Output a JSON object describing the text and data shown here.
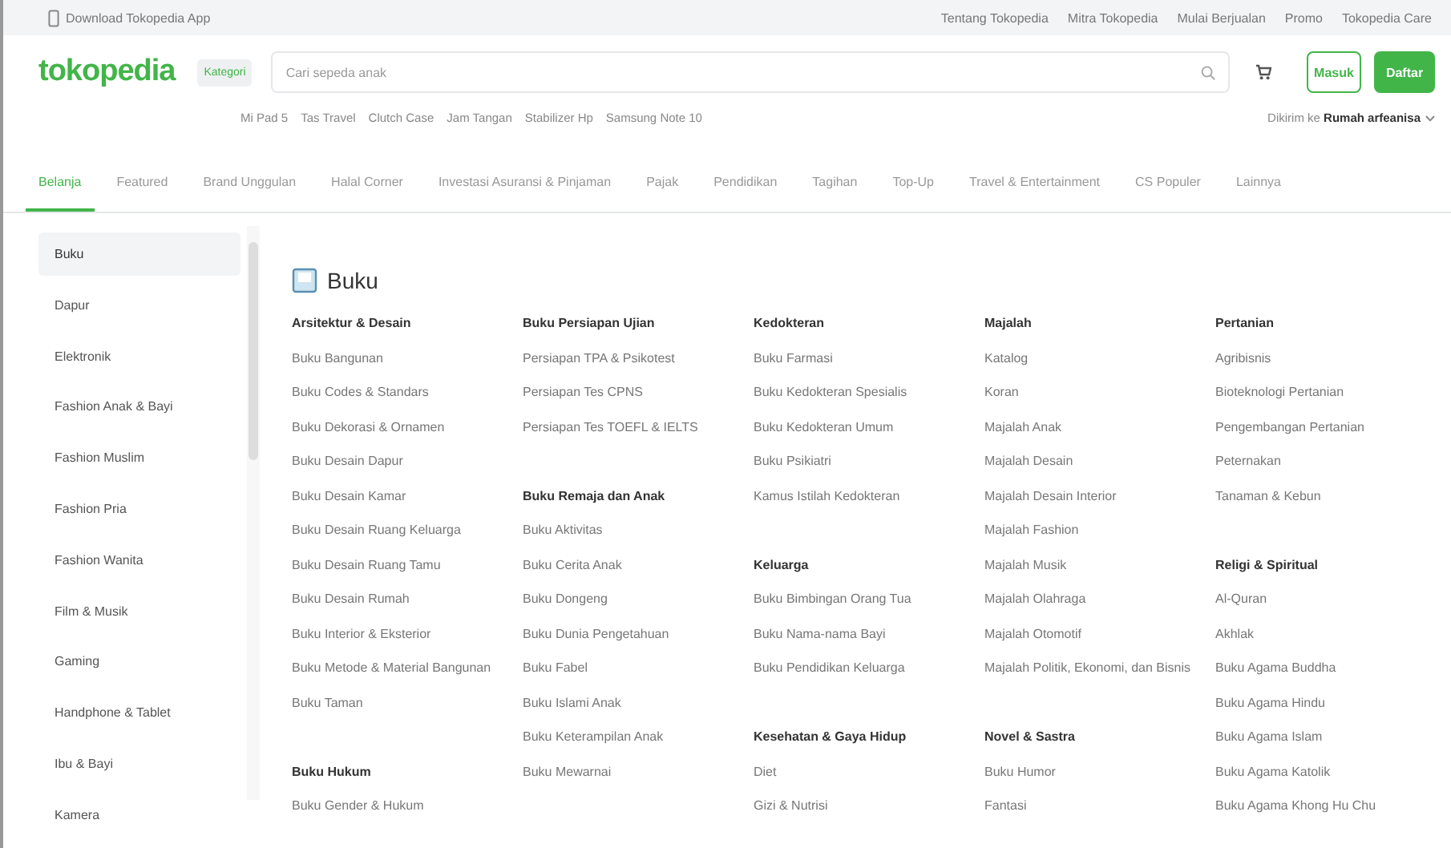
{
  "topbar": {
    "app_link": "Download Tokopedia App",
    "links": [
      "Tentang Tokopedia",
      "Mitra Tokopedia",
      "Mulai Berjualan",
      "Promo",
      "Tokopedia Care"
    ]
  },
  "header": {
    "logo": "tokopedia",
    "category_button": "Kategori",
    "search": {
      "placeholder": "Cari sepeda anak"
    },
    "login_button": "Masuk",
    "register_button": "Daftar",
    "popular_searches": [
      "Mi Pad 5",
      "Tas Travel",
      "Clutch Case",
      "Jam Tangan",
      "Stabilizer Hp",
      "Samsung Note 10"
    ],
    "delivery": "Dikirim ke **Rumah arfeanisa**"
  },
  "tabs": [
    {
      "label": "Belanja",
      "selected": true
    },
    {
      "label": "Featured",
      "selected": false
    },
    {
      "label": "Brand Unggulan",
      "selected": false
    },
    {
      "label": "Halal Corner",
      "selected": false
    },
    {
      "label": "Investasi Asuransi & Pinjaman",
      "selected": false
    },
    {
      "label": "Pajak",
      "selected": false
    },
    {
      "label": "Pendidikan",
      "selected": false
    },
    {
      "label": "Tagihan",
      "selected": false
    },
    {
      "label": "Top-Up",
      "selected": false
    },
    {
      "label": "Travel & Entertainment",
      "selected": false
    },
    {
      "label": "CS Populer",
      "selected": false
    },
    {
      "label": "Lainnya",
      "selected": false
    }
  ],
  "sidebar": {
    "items": [
      {
        "label": "Buku",
        "selected": true
      },
      {
        "label": "Dapur",
        "selected": false
      },
      {
        "label": "Elektronik",
        "selected": false
      },
      {
        "label": "Fashion Anak & Bayi",
        "selected": false
      },
      {
        "label": "Fashion Muslim",
        "selected": false
      },
      {
        "label": "Fashion Pria",
        "selected": false
      },
      {
        "label": "Fashion Wanita",
        "selected": false
      },
      {
        "label": "Film & Musik",
        "selected": false
      },
      {
        "label": "Gaming",
        "selected": false
      },
      {
        "label": "Handphone & Tablet",
        "selected": false
      },
      {
        "label": "Ibu & Bayi",
        "selected": false
      },
      {
        "label": "Kamera",
        "selected": false
      }
    ]
  },
  "content": {
    "title": "Buku",
    "columns": [
      [
        {
          "heading": "Arsitektur & Desain",
          "items": [
            "Buku Bangunan",
            "Buku Codes & Standars",
            "Buku Dekorasi & Ornamen",
            "Buku Desain Dapur",
            "Buku Desain Kamar",
            "Buku Desain Ruang Keluarga",
            "Buku Desain Ruang Tamu",
            "Buku Desain Rumah",
            "Buku Interior & Eksterior",
            "Buku Metode & Material Bangunan",
            "Buku Taman"
          ]
        },
        {
          "heading": "Buku Hukum",
          "items": [
            "Buku Gender & Hukum"
          ]
        }
      ],
      [
        {
          "heading": "Buku Persiapan Ujian",
          "items": [
            "Persiapan TPA & Psikotest",
            "Persiapan Tes CPNS",
            "Persiapan Tes TOEFL & IELTS"
          ]
        },
        {
          "heading": "Buku Remaja dan Anak",
          "items": [
            "Buku Aktivitas",
            "Buku Cerita Anak",
            "Buku Dongeng",
            "Buku Dunia Pengetahuan",
            "Buku Fabel",
            "Buku Islami Anak",
            "Buku Keterampilan Anak",
            "Buku Mewarnai"
          ]
        }
      ],
      [
        {
          "heading": "Kedokteran",
          "items": [
            "Buku Farmasi",
            "Buku Kedokteran Spesialis",
            "Buku Kedokteran Umum",
            "Buku Psikiatri",
            "Kamus Istilah Kedokteran"
          ]
        },
        {
          "heading": "Keluarga",
          "items": [
            "Buku Bimbingan Orang Tua",
            "Buku Nama-nama Bayi",
            "Buku Pendidikan Keluarga"
          ]
        },
        {
          "heading": "Kesehatan & Gaya Hidup",
          "items": [
            "Diet",
            "Gizi & Nutrisi"
          ]
        }
      ],
      [
        {
          "heading": "Majalah",
          "items": [
            "Katalog",
            "Koran",
            "Majalah Anak",
            "Majalah Desain",
            "Majalah Desain Interior",
            "Majalah Fashion",
            "Majalah Musik",
            "Majalah Olahraga",
            "Majalah Otomotif",
            "Majalah Politik, Ekonomi, dan Bisnis"
          ]
        },
        {
          "heading": "Novel & Sastra",
          "items": [
            "Buku Humor",
            "Fantasi"
          ]
        }
      ],
      [
        {
          "heading": "Pertanian",
          "items": [
            "Agribisnis",
            "Bioteknologi Pertanian",
            "Pengembangan Pertanian",
            "Peternakan",
            "Tanaman & Kebun"
          ]
        },
        {
          "heading": "Religi & Spiritual",
          "items": [
            "Al-Quran",
            "Akhlak",
            "Buku Agama Buddha",
            "Buku Agama Hindu",
            "Buku Agama Islam",
            "Buku Agama Katolik",
            "Buku Agama Khong Hu Chu"
          ]
        }
      ]
    ]
  }
}
